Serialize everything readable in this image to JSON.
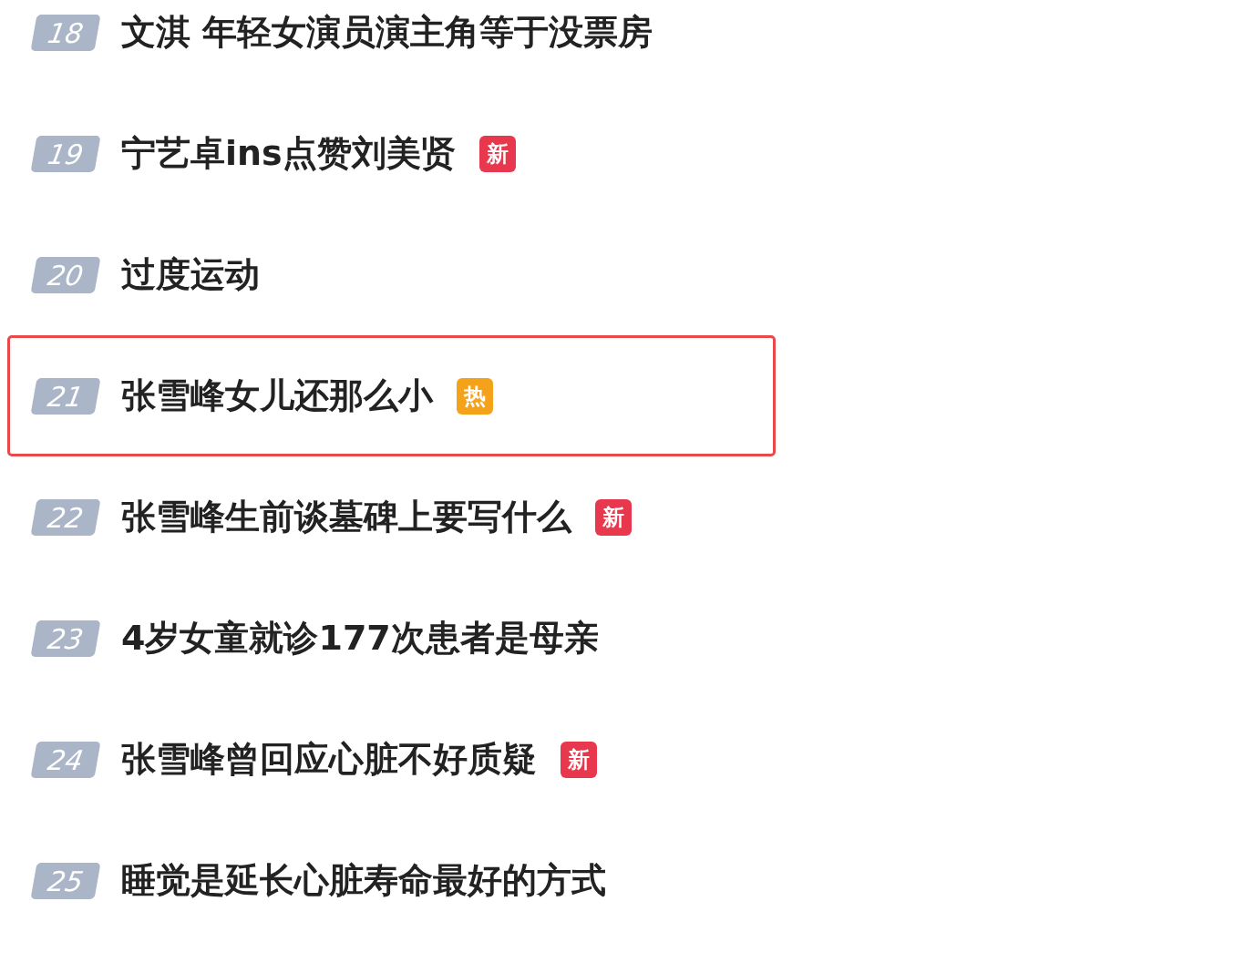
{
  "items": [
    {
      "rank": "18",
      "title": "文淇 年轻女演员演主角等于没票房",
      "highlighted": false
    },
    {
      "rank": "19",
      "title": "宁艺卓ins点赞刘美贤",
      "badge": {
        "kind": "new",
        "text": "新"
      },
      "highlighted": false
    },
    {
      "rank": "20",
      "title": "过度运动",
      "highlighted": false
    },
    {
      "rank": "21",
      "title": "张雪峰女儿还那么小",
      "badge": {
        "kind": "hot",
        "text": "热"
      },
      "highlighted": true
    },
    {
      "rank": "22",
      "title": "张雪峰生前谈墓碑上要写什么",
      "badge": {
        "kind": "new",
        "text": "新"
      },
      "highlighted": false
    },
    {
      "rank": "23",
      "title": "4岁女童就诊177次患者是母亲",
      "highlighted": false
    },
    {
      "rank": "24",
      "title": "张雪峰曾回应心脏不好质疑",
      "badge": {
        "kind": "new",
        "text": "新"
      },
      "highlighted": false
    },
    {
      "rank": "25",
      "title": "睡觉是延长心脏寿命最好的方式",
      "highlighted": false
    }
  ]
}
